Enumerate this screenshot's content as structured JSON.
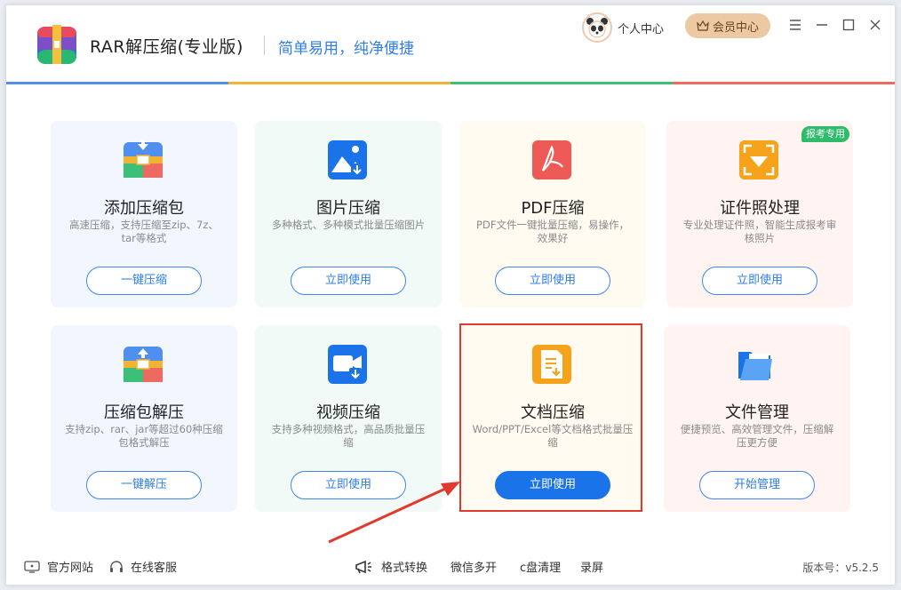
{
  "header": {
    "app_title": "RAR解压缩(专业版)",
    "slogan": "简单易用，纯净便捷",
    "user_center": "个人中心",
    "vip_center": "会员中心"
  },
  "colors": {
    "accent": "#1a73e8",
    "bar": [
      "#4e8ff0",
      "#f2b233",
      "#3cbf78",
      "#ee6a61"
    ]
  },
  "cards": [
    {
      "title": "添加压缩包",
      "desc": "高速压缩，支持压缩至zip、7z、tar等格式",
      "button": "一键压缩",
      "icon": "zip-archive-icon",
      "bg": "#f2f7ff"
    },
    {
      "title": "图片压缩",
      "desc": "多种格式、多种模式批量压缩图片",
      "button": "立即使用",
      "icon": "image-compress-icon",
      "bg": "#f1faf6"
    },
    {
      "title": "PDF压缩",
      "desc": "PDF文件一键批量压缩，易操作，效果好",
      "button": "立即使用",
      "icon": "pdf-icon",
      "bg": "#fffbf1"
    },
    {
      "title": "证件照处理",
      "desc": "专业处理证件照，智能生成报考审核照片",
      "button": "立即使用",
      "icon": "id-photo-icon",
      "bg": "#fff4f1",
      "tag": "报考专用"
    },
    {
      "title": "压缩包解压",
      "desc": "支持zip、rar、jar等超过60种压缩包格式解压",
      "button": "一键解压",
      "icon": "unzip-archive-icon",
      "bg": "#f2f7ff"
    },
    {
      "title": "视频压缩",
      "desc": "支持多种视频格式，高品质批量压缩",
      "button": "立即使用",
      "icon": "video-compress-icon",
      "bg": "#f1faf6"
    },
    {
      "title": "文档压缩",
      "desc": "Word/PPT/Excel等文档格式批量压缩",
      "button": "立即使用",
      "icon": "document-compress-icon",
      "bg": "#fffbf1"
    },
    {
      "title": "文件管理",
      "desc": "便捷预览、高效管理文件，压缩解压更方便",
      "button": "开始管理",
      "icon": "folder-icon",
      "bg": "#fff4f1"
    }
  ],
  "footer": {
    "website": "官方网站",
    "service": "在线客服",
    "format_convert": "格式转换",
    "wechat_multi": "微信多开",
    "c_clean": "c盘清理",
    "record": "录屏",
    "version": "版本号：v5.2.5"
  }
}
